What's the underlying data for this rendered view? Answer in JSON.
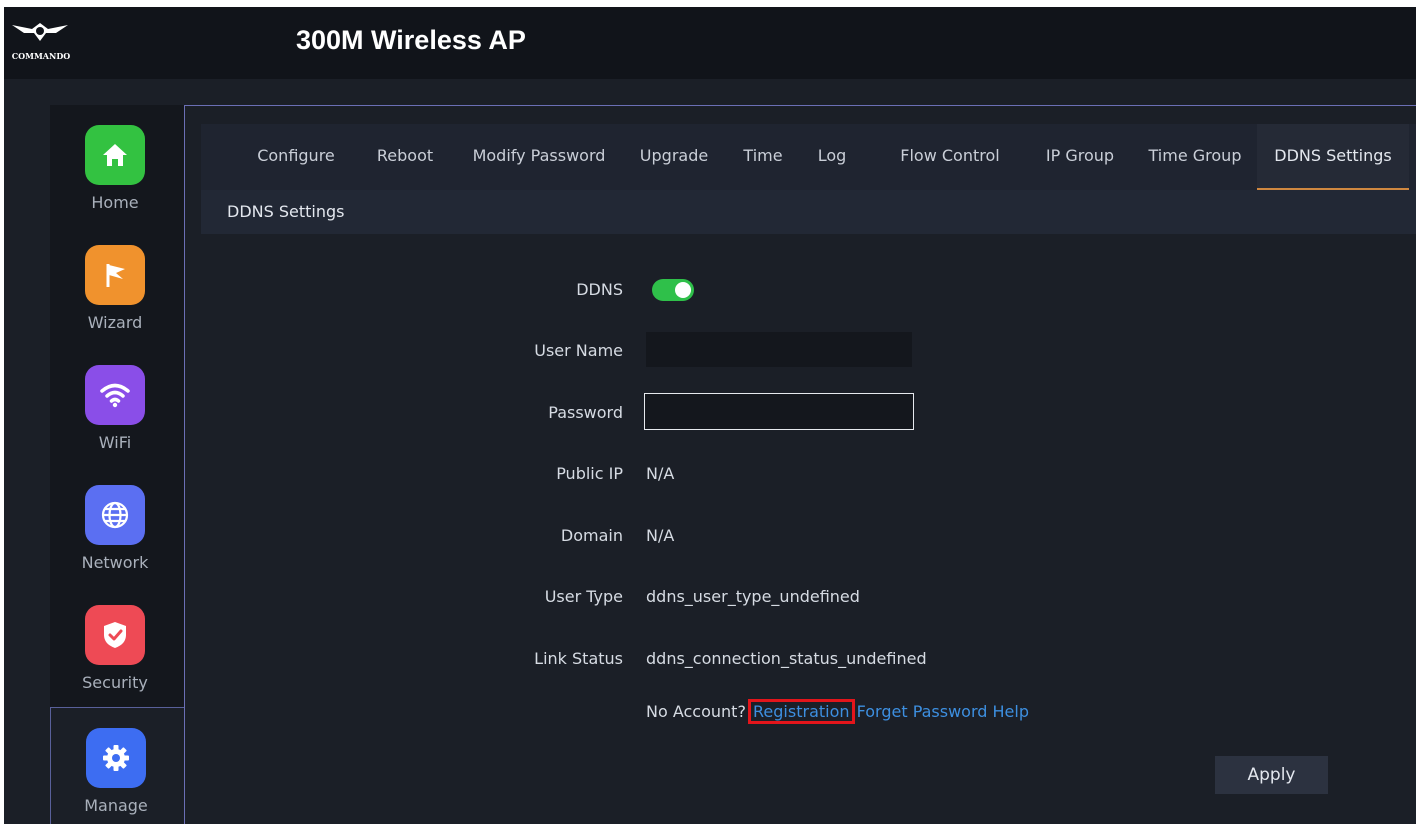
{
  "header": {
    "logo_text": "COMMANDO",
    "title": "300M Wireless AP"
  },
  "sidebar": {
    "items": [
      {
        "label": "Home",
        "icon": "home-icon",
        "color": "#33c241"
      },
      {
        "label": "Wizard",
        "icon": "flag-icon",
        "color": "#f0922d"
      },
      {
        "label": "WiFi",
        "icon": "wifi-icon",
        "color": "#8a4ee8"
      },
      {
        "label": "Network",
        "icon": "globe-icon",
        "color": "#5b6ff2"
      },
      {
        "label": "Security",
        "icon": "shield-icon",
        "color": "#ee4a55"
      },
      {
        "label": "Manage",
        "icon": "gear-icon",
        "color": "#3d6df2"
      }
    ],
    "active": "Manage"
  },
  "tabs": [
    {
      "label": "Configure"
    },
    {
      "label": "Reboot"
    },
    {
      "label": "Modify Password"
    },
    {
      "label": "Upgrade"
    },
    {
      "label": "Time"
    },
    {
      "label": "Log"
    },
    {
      "label": "Flow Control"
    },
    {
      "label": "IP Group"
    },
    {
      "label": "Time Group"
    },
    {
      "label": "DDNS Settings"
    }
  ],
  "active_tab": "DDNS Settings",
  "section": {
    "title": "DDNS Settings"
  },
  "form": {
    "ddns_label": "DDNS",
    "ddns_enabled": true,
    "username_label": "User Name",
    "username_value": "",
    "password_label": "Password",
    "password_value": "",
    "public_ip_label": "Public IP",
    "public_ip_value": "N/A",
    "domain_label": "Domain",
    "domain_value": "N/A",
    "user_type_label": "User Type",
    "user_type_value": "ddns_user_type_undefined",
    "link_status_label": "Link Status",
    "link_status_value": "ddns_connection_status_undefined"
  },
  "links": {
    "no_account": "No Account?",
    "registration": "Registration",
    "forget_password": "Forget Password",
    "help": "Help"
  },
  "apply_label": "Apply",
  "colors": {
    "accent_tab": "#d08840",
    "link": "#3d8fe0",
    "toggle_on": "#2fc04a",
    "highlight": "#e3151b"
  }
}
